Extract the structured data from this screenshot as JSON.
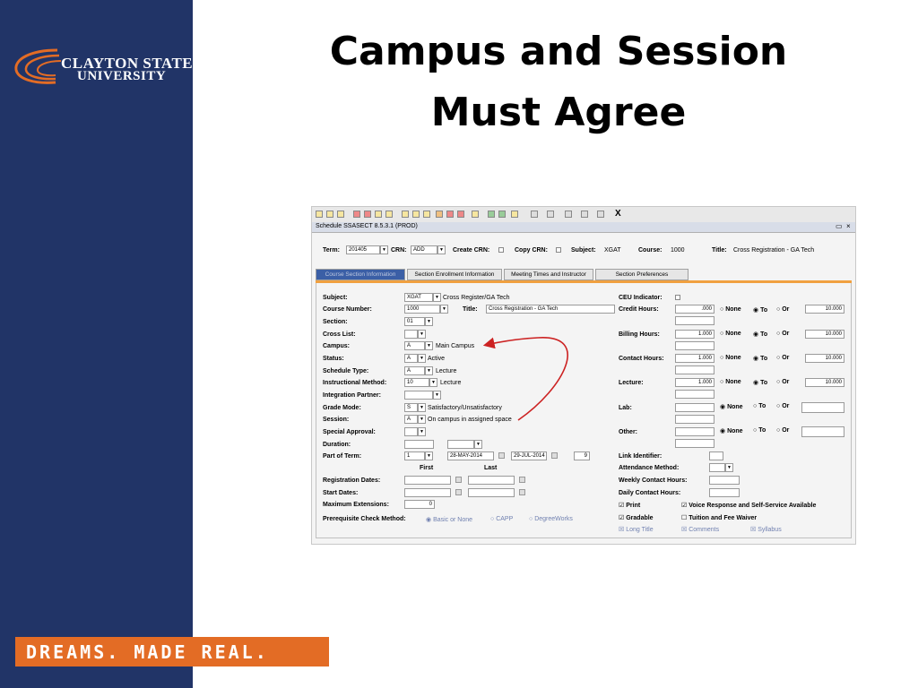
{
  "slide": {
    "title_line1": "Campus and Session",
    "title_line2": "Must Agree",
    "logo_line1": "CLAYTON STATE",
    "logo_line2": "UNIVERSITY",
    "tagline": "DREAMS. MADE REAL.",
    "colors": {
      "left_band": "#213467",
      "tagline_bg": "#e36c25",
      "logo_swoosh": "#e36c25"
    }
  },
  "app": {
    "toolbar_close": "X",
    "window_title": "Schedule  SSASECT  8.5.3.1  (PROD)",
    "key_block": {
      "term_label": "Term:",
      "term_value": "201405",
      "crn_label": "CRN:",
      "crn_value": "ADD",
      "create_crn_label": "Create CRN:",
      "copy_crn_label": "Copy CRN:",
      "subject_label": "Subject:",
      "subject_value": "XGAT",
      "course_label": "Course:",
      "course_value": "1000",
      "title_label": "Title:",
      "title_value": "Cross Registration - GA Tech"
    },
    "tabs": [
      {
        "label": "Course Section Information"
      },
      {
        "label": "Section Enrollment Information"
      },
      {
        "label": "Meeting Times and Instructor"
      },
      {
        "label": "Section Preferences"
      }
    ],
    "form": {
      "subject": {
        "label": "Subject:",
        "value": "XGAT",
        "desc": "Cross Register/GA Tech"
      },
      "course_number": {
        "label": "Course Number:",
        "value": "1000"
      },
      "title": {
        "label": "Title:",
        "value": "Cross Registration - GA Tech"
      },
      "section": {
        "label": "Section:",
        "value": "01"
      },
      "cross_list": {
        "label": "Cross List:"
      },
      "campus": {
        "label": "Campus:",
        "value": "A",
        "desc": "Main Campus"
      },
      "status": {
        "label": "Status:",
        "value": "A",
        "desc": "Active"
      },
      "schedule_type": {
        "label": "Schedule Type:",
        "value": "A",
        "desc": "Lecture"
      },
      "instructional_method": {
        "label": "Instructional Method:",
        "value": "10",
        "desc": "Lecture"
      },
      "integration_partner": {
        "label": "Integration Partner:"
      },
      "grade_mode": {
        "label": "Grade Mode:",
        "value": "S",
        "desc": "Satisfactory/Unsatisfactory"
      },
      "session": {
        "label": "Session:",
        "value": "A",
        "desc": "On campus in assigned space"
      },
      "special_approval": {
        "label": "Special Approval:"
      },
      "duration": {
        "label": "Duration:"
      },
      "part_of_term": {
        "label": "Part of Term:",
        "value": "1",
        "start": "28-MAY-2014",
        "end": "29-JUL-2014",
        "weeks": "9"
      },
      "first_label": "First",
      "last_label": "Last",
      "registration_dates": {
        "label": "Registration Dates:"
      },
      "start_dates": {
        "label": "Start Dates:"
      },
      "maximum_extensions": {
        "label": "Maximum Extensions:",
        "value": "0"
      },
      "prereq": {
        "label": "Prerequisite Check Method:",
        "options": [
          "Basic or None",
          "CAPP",
          "DegreeWorks"
        ]
      },
      "ceu_indicator": {
        "label": "CEU Indicator:"
      },
      "credit_hours": {
        "label": "Credit Hours:",
        "low": ".000",
        "high": "10.000"
      },
      "billing_hours": {
        "label": "Billing Hours:",
        "low": "1.000",
        "high": "10.000"
      },
      "contact_hours": {
        "label": "Contact Hours:",
        "low": "1.000",
        "high": "10.000"
      },
      "lecture": {
        "label": "Lecture:",
        "low": "1.000",
        "high": "10.000"
      },
      "lab": {
        "label": "Lab:"
      },
      "other": {
        "label": "Other:"
      },
      "radio_none": "None",
      "radio_to": "To",
      "radio_or": "Or",
      "link_identifier": {
        "label": "Link Identifier:"
      },
      "attendance_method": {
        "label": "Attendance Method:"
      },
      "weekly_contact_hours": {
        "label": "Weekly Contact Hours:"
      },
      "daily_contact_hours": {
        "label": "Daily Contact  Hours:"
      },
      "print": {
        "label": "Print",
        "checked": true
      },
      "voice_response": {
        "label": "Voice Response and Self-Service Available",
        "checked": true
      },
      "gradable": {
        "label": "Gradable",
        "checked": true
      },
      "tuition_fee_waiver": {
        "label": "Tuition and  Fee Waiver",
        "checked": false
      },
      "long_title": {
        "label": "Long Title"
      },
      "comments": {
        "label": "Comments"
      },
      "syllabus": {
        "label": "Syllabus"
      }
    },
    "annotation_arrow_color": "#cc2222"
  }
}
